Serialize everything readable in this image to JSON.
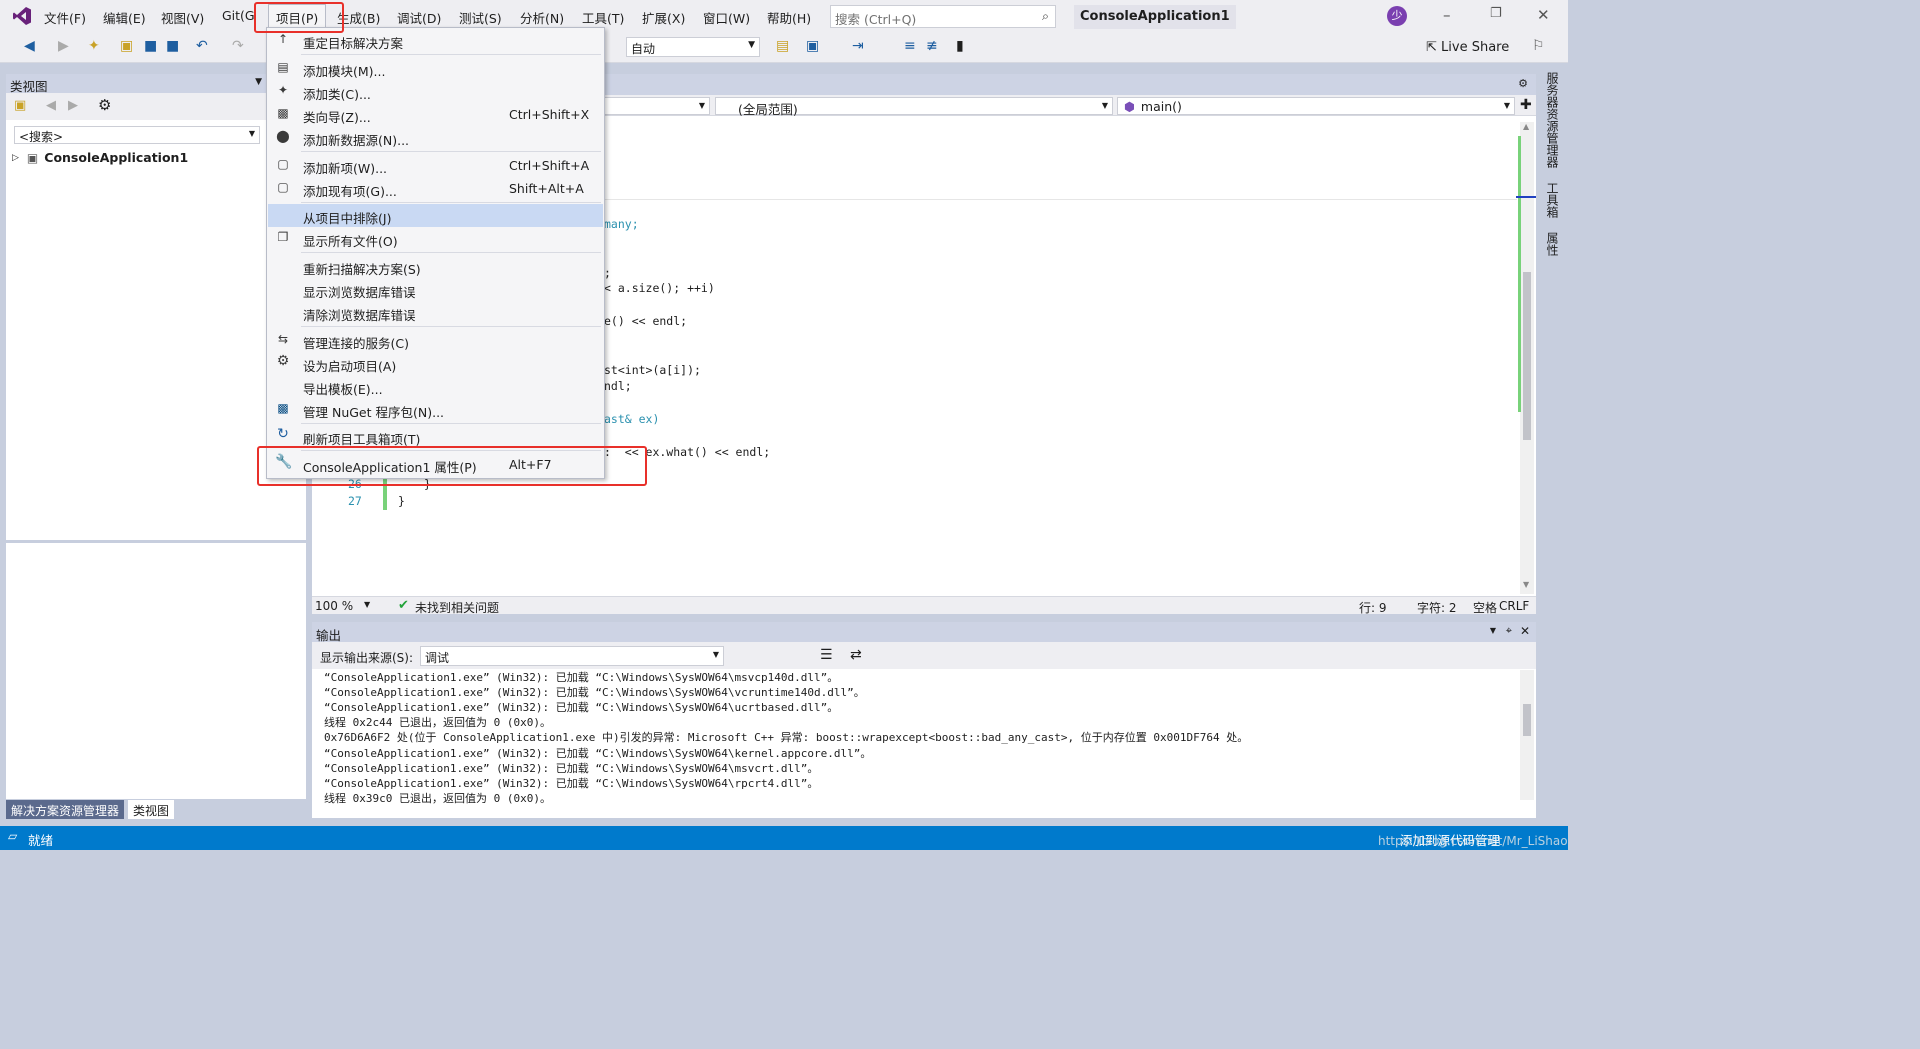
{
  "menubar": {
    "items": [
      "文件(F)",
      "编辑(E)",
      "视图(V)",
      "Git(G",
      "项目(P)",
      "生成(B)",
      "调试(D)",
      "测试(S)",
      "分析(N)",
      "工具(T)",
      "扩展(X)",
      "窗口(W)",
      "帮助(H)"
    ],
    "active": "项目(P)"
  },
  "search": {
    "placeholder": "搜索 (Ctrl+Q)"
  },
  "project_title": "ConsoleApplication1",
  "avatar_text": "少",
  "toolbar": {
    "config": "自动",
    "live_share": "Live Share"
  },
  "classview": {
    "title": "类视图",
    "search": "<搜索>",
    "tree_root": "ConsoleApplication1"
  },
  "bottom_tabs": [
    "解决方案资源管理器",
    "类视图"
  ],
  "editor": {
    "nav_scope": "(全局范围)",
    "nav_member": "main()",
    "zoom": "100 %",
    "issues": "未找到相关问题",
    "line": "行: 9",
    "char": "字符: 2",
    "space": "空格",
    "eol": "CRLF",
    "code_lines": [
      "many;",
      ";",
      "< a.size(); ++i)",
      "e() << endl;",
      "st<int>(a[i]);",
      "ndl;",
      "ast& ex)",
      ":  << ex.what() << endl;",
      "}",
      "}"
    ],
    "line_numbers": [
      "26",
      "27"
    ]
  },
  "output": {
    "title": "输出",
    "source_label": "显示输出来源(S):",
    "source_value": "调试",
    "lines": [
      "“ConsoleApplication1.exe” (Win32): 已加载 “C:\\Windows\\SysWOW64\\msvcp140d.dll”。",
      "“ConsoleApplication1.exe” (Win32): 已加载 “C:\\Windows\\SysWOW64\\vcruntime140d.dll”。",
      "“ConsoleApplication1.exe” (Win32): 已加载 “C:\\Windows\\SysWOW64\\ucrtbased.dll”。",
      "线程 0x2c44 已退出，返回值为 0 (0x0)。",
      "0x76D6A6F2 处(位于 ConsoleApplication1.exe 中)引发的异常: Microsoft C++ 异常: boost::wrapexcept<boost::bad_any_cast>, 位于内存位置 0x001DF764 处。",
      "“ConsoleApplication1.exe” (Win32): 已加载 “C:\\Windows\\SysWOW64\\kernel.appcore.dll”。",
      "“ConsoleApplication1.exe” (Win32): 已加载 “C:\\Windows\\SysWOW64\\msvcrt.dll”。",
      "“ConsoleApplication1.exe” (Win32): 已加载 “C:\\Windows\\SysWOW64\\rpcrt4.dll”。",
      "线程 0x39c0 已退出，返回值为 0 (0x0)。"
    ]
  },
  "right_tabs": [
    "服务器资源管理器",
    "工具箱",
    "属性"
  ],
  "status": {
    "ready": "就绪",
    "source_control": "添加到源代码管理",
    "watermark": "https://blog.csdn.net/Mr_LiShao"
  },
  "project_menu": [
    {
      "icon": "arrow-up-icon",
      "label": "重定目标解决方案",
      "shortcut": ""
    },
    {
      "icon": "add-module-icon",
      "label": "添加模块(M)...",
      "shortcut": ""
    },
    {
      "icon": "add-class-icon",
      "label": "添加类(C)...",
      "shortcut": ""
    },
    {
      "icon": "class-wizard-icon",
      "label": "类向导(Z)...",
      "shortcut": "Ctrl+Shift+X"
    },
    {
      "icon": "add-datasource-icon",
      "label": "添加新数据源(N)...",
      "shortcut": ""
    },
    {
      "icon": "add-new-item-icon",
      "label": "添加新项(W)...",
      "shortcut": "Ctrl+Shift+A"
    },
    {
      "icon": "add-existing-item-icon",
      "label": "添加现有项(G)...",
      "shortcut": "Shift+Alt+A"
    },
    {
      "icon": "",
      "label": "从项目中排除(J)",
      "shortcut": ""
    },
    {
      "icon": "show-all-files-icon",
      "label": "显示所有文件(O)",
      "shortcut": ""
    },
    {
      "icon": "",
      "label": "重新扫描解决方案(S)",
      "shortcut": ""
    },
    {
      "icon": "",
      "label": "显示浏览数据库错误",
      "shortcut": ""
    },
    {
      "icon": "",
      "label": "清除浏览数据库错误",
      "shortcut": ""
    },
    {
      "icon": "connected-services-icon",
      "label": "管理连接的服务(C)",
      "shortcut": ""
    },
    {
      "icon": "gear-icon",
      "label": "设为启动项目(A)",
      "shortcut": ""
    },
    {
      "icon": "",
      "label": "导出模板(E)...",
      "shortcut": ""
    },
    {
      "icon": "nuget-icon",
      "label": "管理 NuGet 程序包(N)...",
      "shortcut": ""
    },
    {
      "icon": "refresh-icon",
      "label": "刷新项目工具箱项(T)",
      "shortcut": ""
    },
    {
      "icon": "wrench-icon",
      "label": "ConsoleApplication1 属性(P)",
      "shortcut": "Alt+F7"
    }
  ],
  "colors": {
    "accent": "#007acc",
    "highlight": "#c9d9f3",
    "annotation_red": "#e8302a",
    "vs_purple": "#68217a"
  }
}
